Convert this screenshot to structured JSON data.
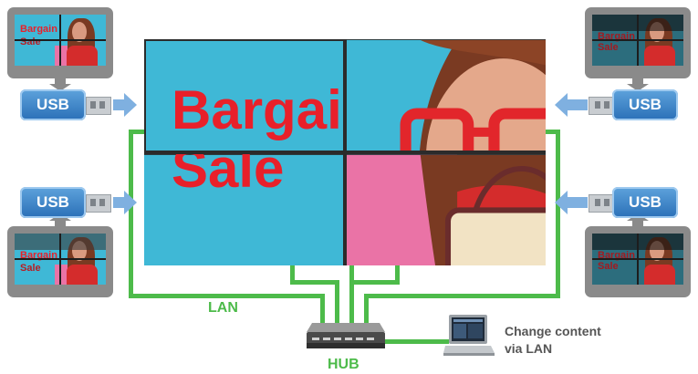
{
  "wall": {
    "headline_line1": "Bargain",
    "headline_line2": "Sale"
  },
  "monitors": [
    {
      "position": "top-left",
      "headline_line1": "Bargain",
      "headline_line2": "Sale"
    },
    {
      "position": "bottom-left",
      "headline_line1": "Bargain",
      "headline_line2": "Sale"
    },
    {
      "position": "top-right",
      "headline_line1": "Bargain",
      "headline_line2": "Sale"
    },
    {
      "position": "bottom-right",
      "headline_line1": "Bargain",
      "headline_line2": "Sale"
    }
  ],
  "usb": {
    "label": "USB"
  },
  "labels": {
    "lan": "LAN",
    "hub": "HUB",
    "change_content_line1": "Change content",
    "change_content_line2": "via LAN"
  },
  "colors": {
    "wire": "#4dbb4a",
    "screen_bg": "#3fb8d6",
    "headline": "#e8202a",
    "usb_body": "#2a6fb7",
    "arrow": "#7fb0e0",
    "monitor_frame": "#8a8a8a"
  },
  "icons": [
    "usb-drive-icon",
    "arrow-icon",
    "network-hub-icon",
    "laptop-icon"
  ]
}
